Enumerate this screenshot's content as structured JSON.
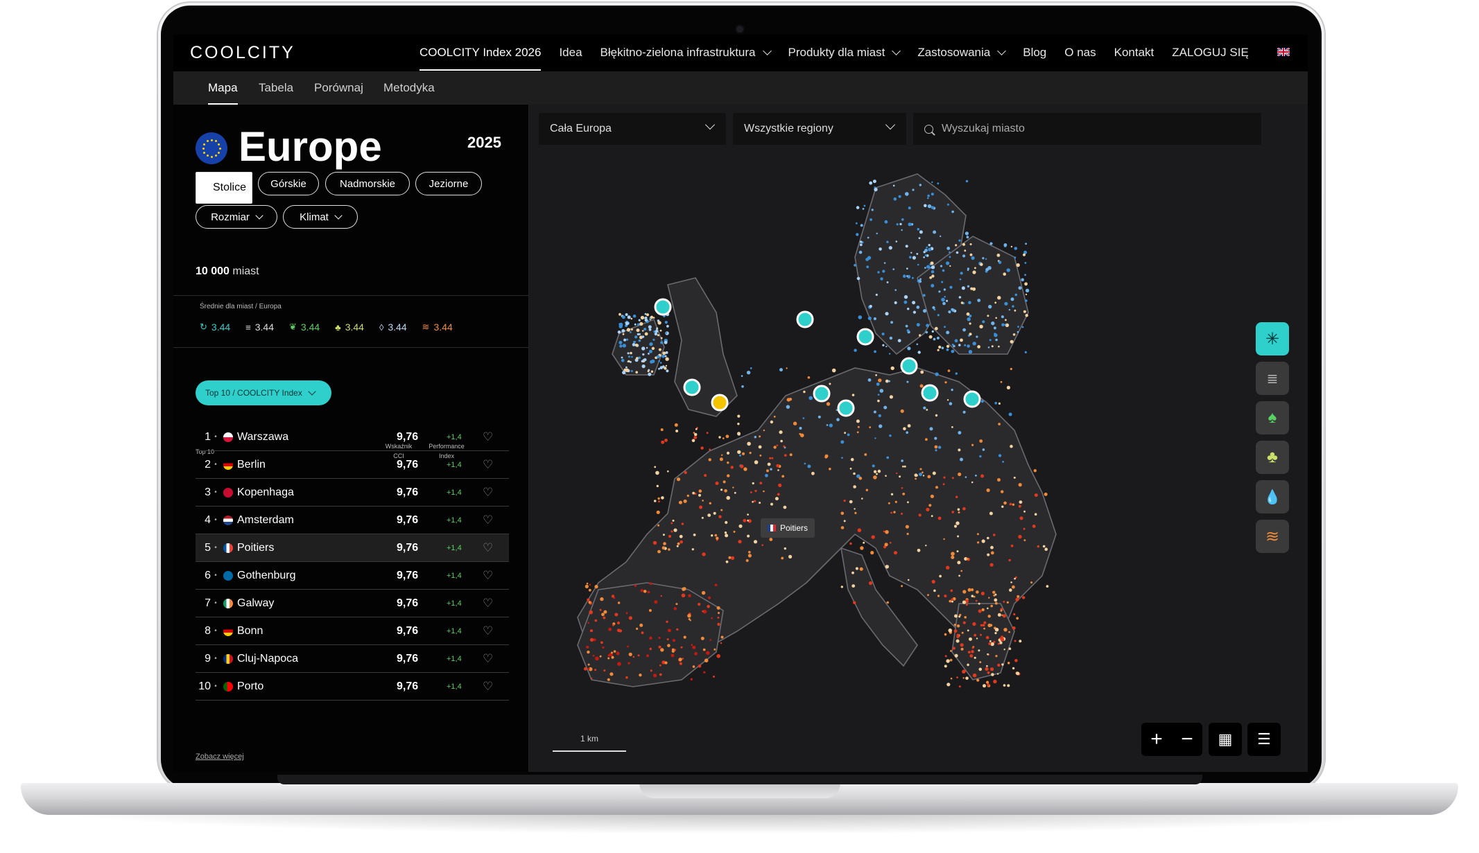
{
  "header": {
    "logo": "COOLCITY",
    "nav": [
      {
        "label": "COOLCITY Index 2026",
        "active": true
      },
      {
        "label": "Idea"
      },
      {
        "label": "Błękitno-zielona infrastruktura",
        "dropdown": true
      },
      {
        "label": "Produkty dla miast",
        "dropdown": true
      },
      {
        "label": "Zastosowania",
        "dropdown": true
      },
      {
        "label": "Blog"
      },
      {
        "label": "O nas"
      },
      {
        "label": "Kontakt"
      },
      {
        "label": "ZALOGUJ SIĘ"
      }
    ],
    "language_icon": "uk-flag-icon"
  },
  "subnav": {
    "tabs": [
      "Mapa",
      "Tabela",
      "Porównaj",
      "Metodyka"
    ],
    "active": "Mapa"
  },
  "panel": {
    "region": "Europe",
    "year": "2025",
    "filter_chips": [
      "Stolice",
      "Górskie",
      "Nadmorskie",
      "Jeziorne"
    ],
    "selected_chip": "Stolice",
    "dropdown_filters": [
      "Rozmiar",
      "Klimat"
    ],
    "city_count": "10 000",
    "city_count_suffix": "miast",
    "averages_label": "Średnie dla miast / Europa",
    "averages": [
      {
        "icon": "cci-icon",
        "value": "3.44",
        "color": "#2fd0cb"
      },
      {
        "icon": "shade-icon",
        "value": "3.44",
        "color": "#dddddd"
      },
      {
        "icon": "leaf-icon",
        "value": "3.44",
        "color": "#58d062"
      },
      {
        "icon": "tree-icon",
        "value": "3.44",
        "color": "#c9e06a"
      },
      {
        "icon": "water-drop-icon",
        "value": "3.44",
        "color": "#bcd6f5"
      },
      {
        "icon": "heat-icon",
        "value": "3.44",
        "color": "#f08a3a"
      }
    ],
    "ranking_dropdown": "Top 10 / COOLCITY Index",
    "table_label": "Top 10",
    "col_score_line1": "Wskaźnik",
    "col_score_line2": "CCI",
    "col_perf_line1": "Performance",
    "col_perf_line2": "Index",
    "rows": [
      {
        "rank": "1",
        "city": "Warszawa",
        "flag": "pl",
        "score": "9,76",
        "delta": "+1,4"
      },
      {
        "rank": "2",
        "city": "Berlin",
        "flag": "de",
        "score": "9,76",
        "delta": "+1,4"
      },
      {
        "rank": "3",
        "city": "Kopenhaga",
        "flag": "dk",
        "score": "9,76",
        "delta": "+1,4"
      },
      {
        "rank": "4",
        "city": "Amsterdam",
        "flag": "nl",
        "score": "9,76",
        "delta": "+1,4"
      },
      {
        "rank": "5",
        "city": "Poitiers",
        "flag": "fr",
        "score": "9,76",
        "delta": "+1,4",
        "highlighted": true
      },
      {
        "rank": "6",
        "city": "Gothenburg",
        "flag": "se",
        "score": "9,76",
        "delta": "+1,4"
      },
      {
        "rank": "7",
        "city": "Galway",
        "flag": "ie",
        "score": "9,76",
        "delta": "+1,4"
      },
      {
        "rank": "8",
        "city": "Bonn",
        "flag": "de",
        "score": "9,76",
        "delta": "+1,4"
      },
      {
        "rank": "9",
        "city": "Cluj-Napoca",
        "flag": "ro",
        "score": "9,76",
        "delta": "+1,4"
      },
      {
        "rank": "10",
        "city": "Porto",
        "flag": "pt",
        "score": "9,76",
        "delta": "+1,4"
      }
    ],
    "see_more": "Zobacz więcej"
  },
  "map": {
    "country_select": "Cała Europa",
    "region_select": "Wszystkie regiony",
    "search_placeholder": "Wyszukaj miasto",
    "tooltip_city": "Poitiers",
    "scale_label": "1 km",
    "layer_buttons": [
      "snowflake-icon",
      "shade-icon",
      "tree-icon",
      "trees-icon",
      "water-drop-icon",
      "heat-icon"
    ],
    "controls": [
      "zoom-in-icon",
      "zoom-out-icon",
      "grid-view-icon",
      "list-view-icon"
    ]
  },
  "colors": {
    "accent": "#2fd0cb",
    "highlight_pin": "#f5c400",
    "positive": "#58d062"
  }
}
